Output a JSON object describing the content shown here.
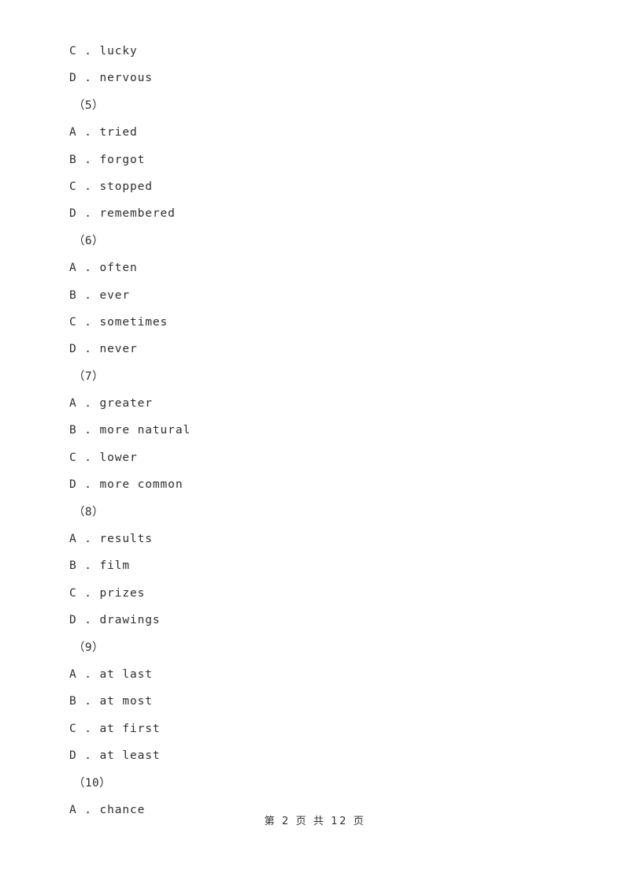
{
  "document": {
    "page_background": "#ffffff",
    "text_color": "#2e2e2e",
    "lines": [
      {
        "kind": "option",
        "text": "C . lucky"
      },
      {
        "kind": "option",
        "text": "D . nervous"
      },
      {
        "kind": "question_number",
        "text": "（5）"
      },
      {
        "kind": "option",
        "text": "A . tried"
      },
      {
        "kind": "option",
        "text": "B . forgot"
      },
      {
        "kind": "option",
        "text": "C . stopped"
      },
      {
        "kind": "option",
        "text": "D . remembered"
      },
      {
        "kind": "question_number",
        "text": "（6）"
      },
      {
        "kind": "option",
        "text": "A . often"
      },
      {
        "kind": "option",
        "text": "B . ever"
      },
      {
        "kind": "option",
        "text": "C . sometimes"
      },
      {
        "kind": "option",
        "text": "D . never"
      },
      {
        "kind": "question_number",
        "text": "（7）"
      },
      {
        "kind": "option",
        "text": "A . greater"
      },
      {
        "kind": "option",
        "text": "B . more natural"
      },
      {
        "kind": "option",
        "text": "C . lower"
      },
      {
        "kind": "option",
        "text": "D . more common"
      },
      {
        "kind": "question_number",
        "text": "（8）"
      },
      {
        "kind": "option",
        "text": "A . results"
      },
      {
        "kind": "option",
        "text": "B . film"
      },
      {
        "kind": "option",
        "text": "C . prizes"
      },
      {
        "kind": "option",
        "text": "D . drawings"
      },
      {
        "kind": "question_number",
        "text": "（9）"
      },
      {
        "kind": "option",
        "text": "A . at last"
      },
      {
        "kind": "option",
        "text": "B . at most"
      },
      {
        "kind": "option",
        "text": "C . at first"
      },
      {
        "kind": "option",
        "text": "D . at least"
      },
      {
        "kind": "question_number",
        "text": "（10）"
      },
      {
        "kind": "option",
        "text": "A . chance"
      }
    ]
  },
  "footer": {
    "text": "第 2 页 共 12 页",
    "current_page": "2",
    "total_pages": "12"
  }
}
